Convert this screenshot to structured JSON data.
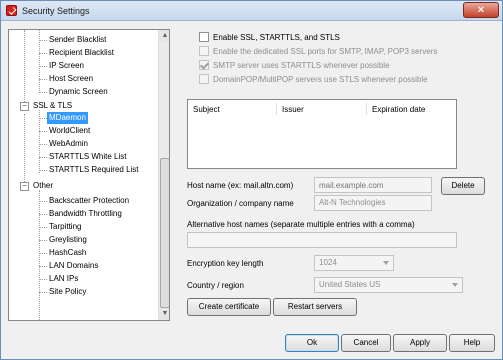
{
  "window": {
    "title": "Security Settings",
    "close_label": "×"
  },
  "tree": {
    "items": [
      "Sender Blacklist",
      "Recipient Blacklist",
      "IP Screen",
      "Host Screen",
      "Dynamic Screen",
      "SSL & TLS",
      "MDaemon",
      "WorldClient",
      "WebAdmin",
      "STARTTLS White List",
      "STARTTLS Required List",
      "Other",
      "Backscatter Protection",
      "Bandwidth Throttling",
      "Tarpitting",
      "Greylisting",
      "HashCash",
      "LAN Domains",
      "LAN IPs",
      "Site Policy"
    ],
    "selected": "MDaemon",
    "expander_glyph": "−",
    "scroll_up": "▲",
    "scroll_down": "▼"
  },
  "ssl": {
    "enable_label": "Enable SSL, STARTTLS, and STLS",
    "dedicated_ports_label": "Enable the dedicated SSL ports for SMTP, IMAP, POP3 servers",
    "smtp_starttls_label": "SMTP server uses STARTTLS whenever possible",
    "domainpop_label": "DomainPOP/MultiPOP servers use STLS whenever possible"
  },
  "certificates": {
    "columns": [
      "Subject",
      "Issuer",
      "Expiration date"
    ]
  },
  "form": {
    "host_name_label": "Host name (ex: mail.altn.com)",
    "host_name_placeholder": "mail.example.com",
    "delete_label": "Delete",
    "org_label": "Organization / company name",
    "org_value": "Alt-N Technologies",
    "alt_hosts_label": "Alternative host names (separate multiple entries with a comma)",
    "alt_hosts_value": "",
    "key_length_label": "Encryption key length",
    "key_length_value": "1024",
    "country_label": "Country / region",
    "country_value": "United States US",
    "create_cert_label": "Create certificate",
    "restart_label": "Restart servers"
  },
  "footer": {
    "ok": "Ok",
    "cancel": "Cancel",
    "apply": "Apply",
    "help": "Help"
  }
}
